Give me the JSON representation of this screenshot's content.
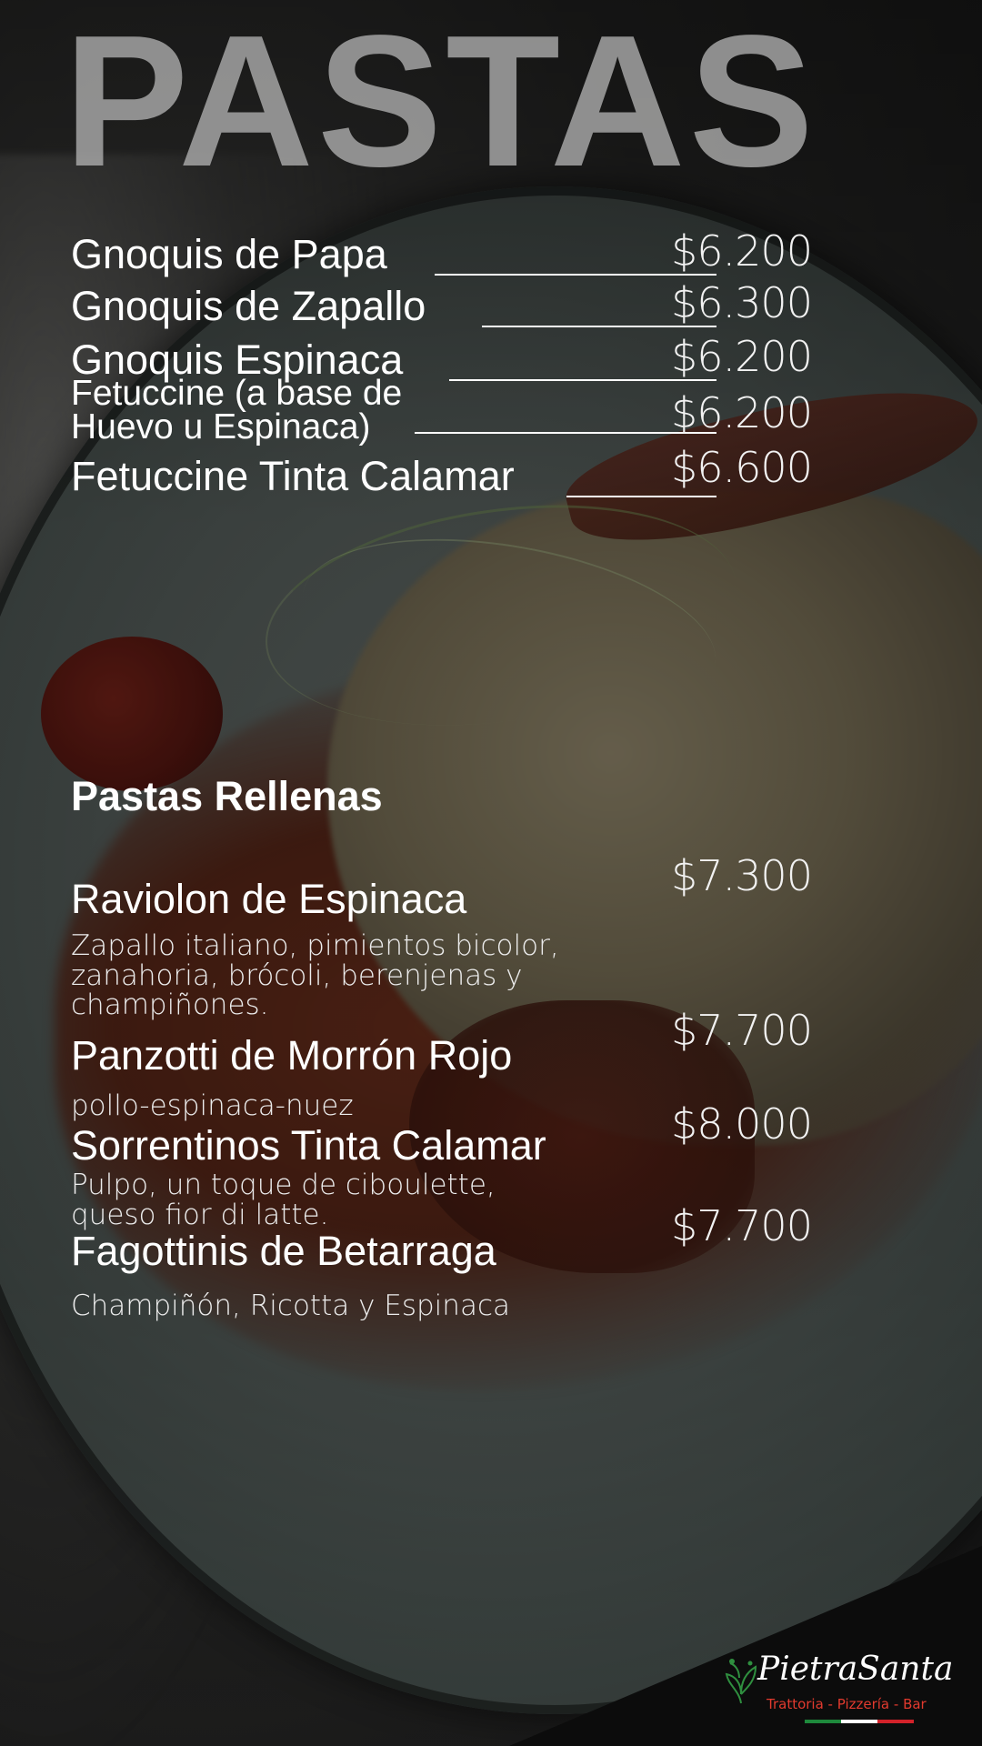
{
  "title": "PASTAS",
  "pastas": [
    {
      "name": "Gnoquis de Papa",
      "price": "$6.200"
    },
    {
      "name": "Gnoquis de Zapallo",
      "price": "$6.300"
    },
    {
      "name": "Gnoquis Espinaca",
      "price": "$6.200"
    },
    {
      "name_line1": "Fetuccine (a base de",
      "name_line2": "Huevo u Espinaca)",
      "price": "$6.200"
    },
    {
      "name": "Fetuccine Tinta Calamar",
      "price": "$6.600"
    }
  ],
  "rellenas": {
    "heading": "Pastas Rellenas",
    "items": [
      {
        "name": "Raviolon de Espinaca",
        "price": "$7.300",
        "description": "Zapallo italiano, pimientos bicolor, zanahoria, brócoli, berenjenas y champiñones."
      },
      {
        "name": "Panzotti de Morrón Rojo",
        "price": "$7.700",
        "description": "pollo-espinaca-nuez"
      },
      {
        "name": "Sorrentinos Tinta Calamar",
        "price": "$8.000",
        "description": "Pulpo, un toque de ciboulette, queso fior di latte."
      },
      {
        "name": "Fagottinis de Betarraga",
        "price": "$7.700",
        "description": "Champiñón, Ricotta y Espinaca"
      }
    ]
  },
  "logo": {
    "name": "PietraSanta",
    "tagline": "Trattoria - Pizzería - Bar"
  },
  "colors": {
    "title": "#aaaaaa",
    "logo_red": "#e23a2e",
    "flag_green": "#1e8a3c",
    "flag_white": "#ffffff",
    "flag_red": "#d3222a"
  }
}
